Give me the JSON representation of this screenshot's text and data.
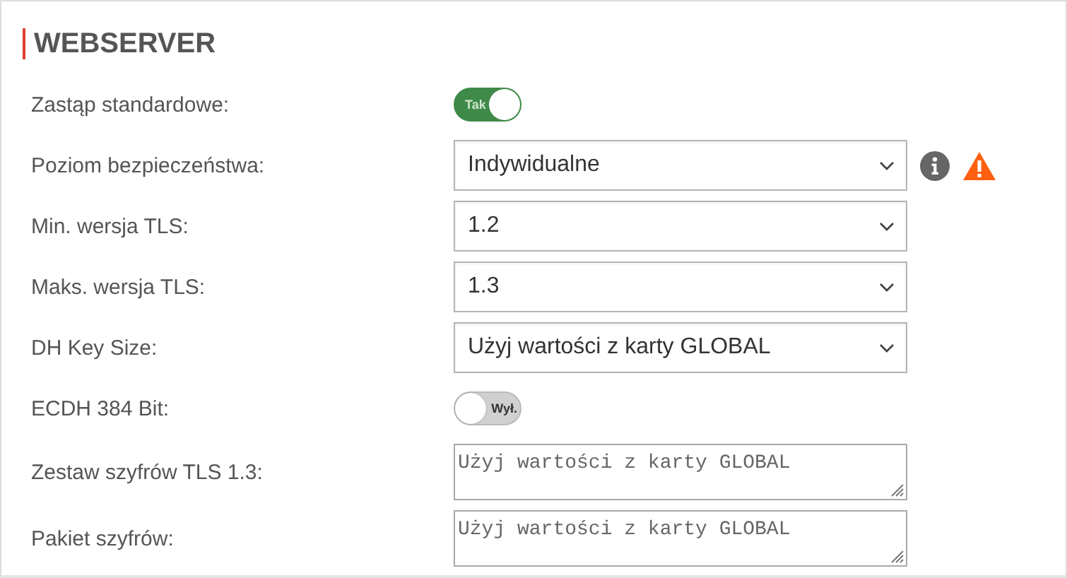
{
  "section": {
    "title": "WEBSERVER"
  },
  "fields": [
    {
      "kind": "toggle",
      "label": "Zastąp standardowe:",
      "on": true,
      "text": "Tak"
    },
    {
      "kind": "select",
      "label": "Poziom bezpieczeństwa:",
      "value": "Indywidualne",
      "info": true,
      "warning": true
    },
    {
      "kind": "select",
      "label": "Min. wersja TLS:",
      "value": "1.2"
    },
    {
      "kind": "select",
      "label": "Maks. wersja TLS:",
      "value": "1.3"
    },
    {
      "kind": "select",
      "label": "DH Key Size:",
      "value": "Użyj wartości z karty GLOBAL"
    },
    {
      "kind": "toggle",
      "label": "ECDH 384 Bit:",
      "on": false,
      "text": "Wył."
    },
    {
      "kind": "textarea",
      "label": "Zestaw szyfrów TLS 1.3:",
      "placeholder": "Użyj wartości z karty GLOBAL"
    },
    {
      "kind": "textarea",
      "label": "Pakiet szyfrów:",
      "placeholder": "Użyj wartości z karty GLOBAL"
    }
  ]
}
